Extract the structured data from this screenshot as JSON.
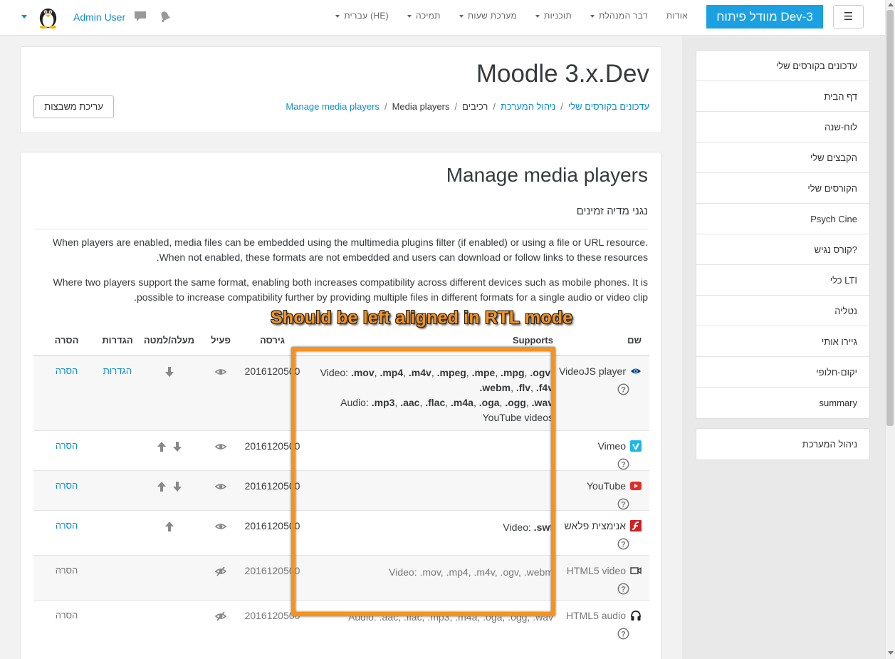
{
  "navbar": {
    "toggle_label": "☰",
    "brand": "מוודל פיתוח Dev-3",
    "links": [
      {
        "label": "אודות",
        "dropdown": false
      },
      {
        "label": "דבר המנהלת",
        "dropdown": true
      },
      {
        "label": "תוכניות",
        "dropdown": true
      },
      {
        "label": "מערכת שעות",
        "dropdown": true
      },
      {
        "label": "תמיכה",
        "dropdown": true
      },
      {
        "label": "עברית (HE)",
        "dropdown": true
      }
    ],
    "user_name": "Admin User",
    "accent": "#1ba0e2"
  },
  "header": {
    "site_title": "Moodle 3.x.Dev",
    "breadcrumb": [
      {
        "label": "עדכונים בקורסים שלי",
        "link": true
      },
      {
        "label": "ניהול המערכת",
        "link": true
      },
      {
        "label": "רכיבים",
        "link": false
      },
      {
        "label": "Media players",
        "link": false
      },
      {
        "label": "Manage media players",
        "link": true
      }
    ],
    "edit_button": "עריכת משבצות"
  },
  "sidebar": {
    "nav_items": [
      "עדכונים בקורסים שלי",
      "דף הבית",
      "לוח-שנה",
      "הקבצים שלי",
      "הקורסים שלי",
      "Psych Cine",
      "קורס נגיש?",
      "כלי LTI",
      "נטליה",
      "גיירו אותי",
      "יקום-חלופי",
      "summary"
    ],
    "admin_item": "ניהול המערכת"
  },
  "main": {
    "heading": "Manage media players",
    "subheading": "נגני מדיה זמינים",
    "para1": "When players are enabled, media files can be embedded using the multimedia plugins filter (if enabled) or using a file or URL resource. When not enabled, these formats are not embedded and users can download or follow links to these resources.",
    "para2": "Where two players support the same format, enabling both increases compatibility across different devices such as mobile phones. It is possible to increase compatibility further by providing multiple files in different formats for a single audio or video clip.",
    "table": {
      "headers": {
        "name": "שם",
        "supports": "Supports",
        "version": "גירסה",
        "enabled": "פעיל",
        "order": "מעלה/למטה",
        "settings": "הגדרות",
        "remove": "הסרה"
      },
      "rows": [
        {
          "name": "VideoJS player",
          "icon": "videojs-icon",
          "help": true,
          "enabled": true,
          "order": [
            "down"
          ],
          "settings": "הגדרות",
          "remove": "הסרה",
          "version": "2016120500",
          "supports": [
            {
              "prefix": "Video: ",
              "formats": [
                ".mov",
                ".mp4",
                ".m4v",
                ".mpeg",
                ".mpe",
                ".mpg",
                ".ogv",
                ".webm",
                ".flv",
                ".f4v"
              ]
            },
            {
              "prefix": "Audio: ",
              "formats": [
                ".mp3",
                ".aac",
                ".flac",
                ".m4a",
                ".oga",
                ".ogg",
                ".wav"
              ]
            },
            {
              "prefix": "",
              "text": "YouTube videos"
            }
          ]
        },
        {
          "name": "Vimeo",
          "icon": "vimeo-icon",
          "help": true,
          "enabled": true,
          "order": [
            "down",
            "up"
          ],
          "settings": "",
          "remove": "הסרה",
          "version": "2016120500",
          "supports": []
        },
        {
          "name": "YouTube",
          "icon": "youtube-icon",
          "help": true,
          "enabled": true,
          "order": [
            "down",
            "up"
          ],
          "settings": "",
          "remove": "הסרה",
          "version": "2016120500",
          "supports": []
        },
        {
          "name": "אנימצית פלאש",
          "icon": "flash-icon",
          "help": true,
          "enabled": true,
          "order": [
            "up"
          ],
          "settings": "",
          "remove": "הסרה",
          "version": "2016120500",
          "supports": [
            {
              "prefix": "Video: ",
              "formats": [
                ".swf"
              ]
            }
          ]
        },
        {
          "name": "HTML5 video",
          "icon": "video-camera-icon",
          "help": true,
          "enabled": false,
          "order": [],
          "settings": "",
          "remove": "הסרה",
          "version": "2016120500",
          "supports_plain": "Video: .mov, .mp4, .m4v, .ogv, .webm"
        },
        {
          "name": "HTML5 audio",
          "icon": "headphones-icon",
          "help": true,
          "enabled": false,
          "order": [],
          "settings": "",
          "remove": "הסרה",
          "version": "2016120500",
          "supports_plain": "Audio: .aac, .flac, .mp3, .m4a, .oga, .ogg, .wav"
        }
      ]
    }
  },
  "annotation": {
    "text": "Should be left aligned in RTL mode",
    "color": "#f6931d"
  }
}
